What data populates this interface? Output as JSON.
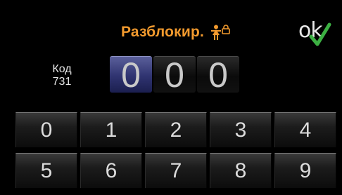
{
  "header": {
    "title": "Разблокир.",
    "icons": [
      "child-icon",
      "lock-icon"
    ]
  },
  "ok_button": {
    "label": "ok",
    "icon": "checkmark-icon",
    "check_color": "#3cb043"
  },
  "code": {
    "label_line1": "Код",
    "label_line2": "731",
    "digits": [
      "0",
      "0",
      "0"
    ],
    "active_index": 0
  },
  "keypad": {
    "row1": [
      "0",
      "1",
      "2",
      "3",
      "4"
    ],
    "row2": [
      "5",
      "6",
      "7",
      "8",
      "9"
    ]
  },
  "colors": {
    "accent_orange": "#f29a2e",
    "active_digit_blue": "#2f3370",
    "background": "#000000"
  }
}
